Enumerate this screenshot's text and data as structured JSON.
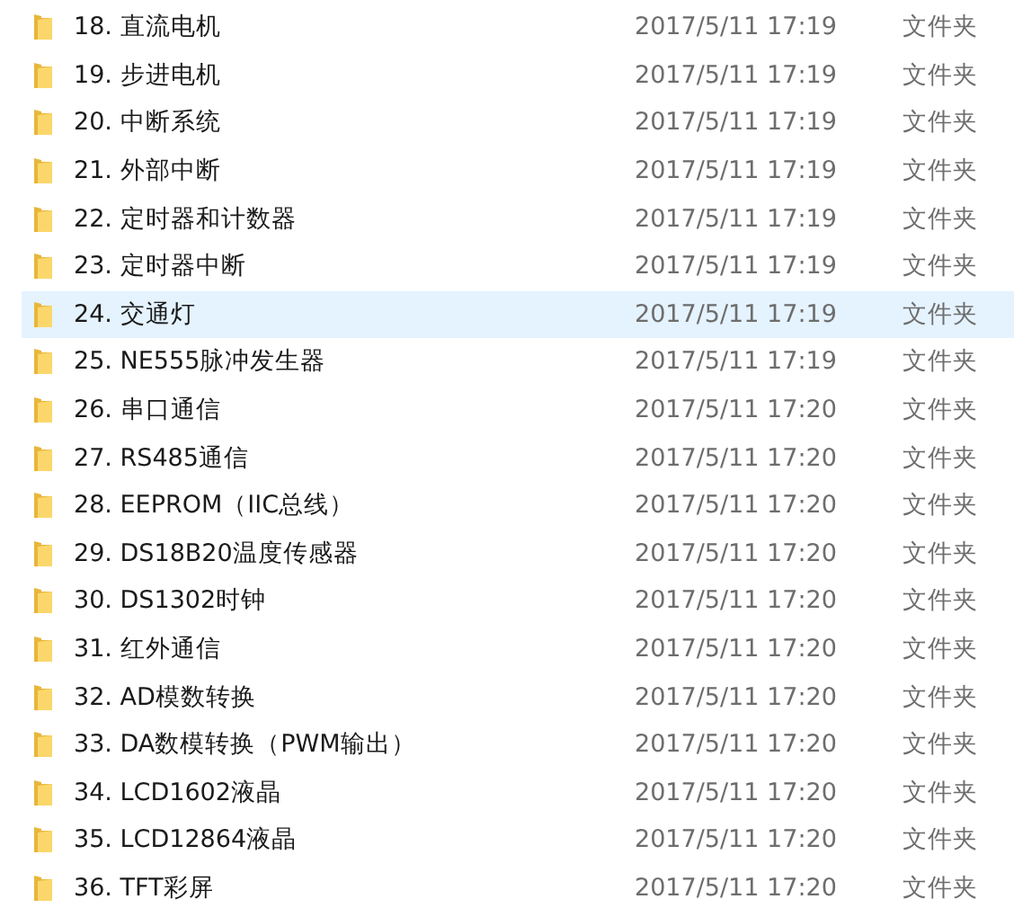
{
  "files": [
    {
      "name": "18. 直流电机",
      "modified": "2017/5/11 17:19",
      "type": "文件夹",
      "selected": false
    },
    {
      "name": "19. 步进电机",
      "modified": "2017/5/11 17:19",
      "type": "文件夹",
      "selected": false
    },
    {
      "name": "20. 中断系统",
      "modified": "2017/5/11 17:19",
      "type": "文件夹",
      "selected": false
    },
    {
      "name": "21. 外部中断",
      "modified": "2017/5/11 17:19",
      "type": "文件夹",
      "selected": false
    },
    {
      "name": "22. 定时器和计数器",
      "modified": "2017/5/11 17:19",
      "type": "文件夹",
      "selected": false
    },
    {
      "name": "23. 定时器中断",
      "modified": "2017/5/11 17:19",
      "type": "文件夹",
      "selected": false
    },
    {
      "name": "24. 交通灯",
      "modified": "2017/5/11 17:19",
      "type": "文件夹",
      "selected": true
    },
    {
      "name": "25. NE555脉冲发生器",
      "modified": "2017/5/11 17:19",
      "type": "文件夹",
      "selected": false
    },
    {
      "name": "26. 串口通信",
      "modified": "2017/5/11 17:20",
      "type": "文件夹",
      "selected": false
    },
    {
      "name": "27. RS485通信",
      "modified": "2017/5/11 17:20",
      "type": "文件夹",
      "selected": false
    },
    {
      "name": "28. EEPROM（IIC总线）",
      "modified": "2017/5/11 17:20",
      "type": "文件夹",
      "selected": false
    },
    {
      "name": "29. DS18B20温度传感器",
      "modified": "2017/5/11 17:20",
      "type": "文件夹",
      "selected": false
    },
    {
      "name": "30. DS1302时钟",
      "modified": "2017/5/11 17:20",
      "type": "文件夹",
      "selected": false
    },
    {
      "name": "31. 红外通信",
      "modified": "2017/5/11 17:20",
      "type": "文件夹",
      "selected": false
    },
    {
      "name": "32. AD模数转换",
      "modified": "2017/5/11 17:20",
      "type": "文件夹",
      "selected": false
    },
    {
      "name": "33. DA数模转换（PWM输出）",
      "modified": "2017/5/11 17:20",
      "type": "文件夹",
      "selected": false
    },
    {
      "name": "34. LCD1602液晶",
      "modified": "2017/5/11 17:20",
      "type": "文件夹",
      "selected": false
    },
    {
      "name": "35. LCD12864液晶",
      "modified": "2017/5/11 17:20",
      "type": "文件夹",
      "selected": false
    },
    {
      "name": "36. TFT彩屏",
      "modified": "2017/5/11 17:20",
      "type": "文件夹",
      "selected": false
    }
  ]
}
